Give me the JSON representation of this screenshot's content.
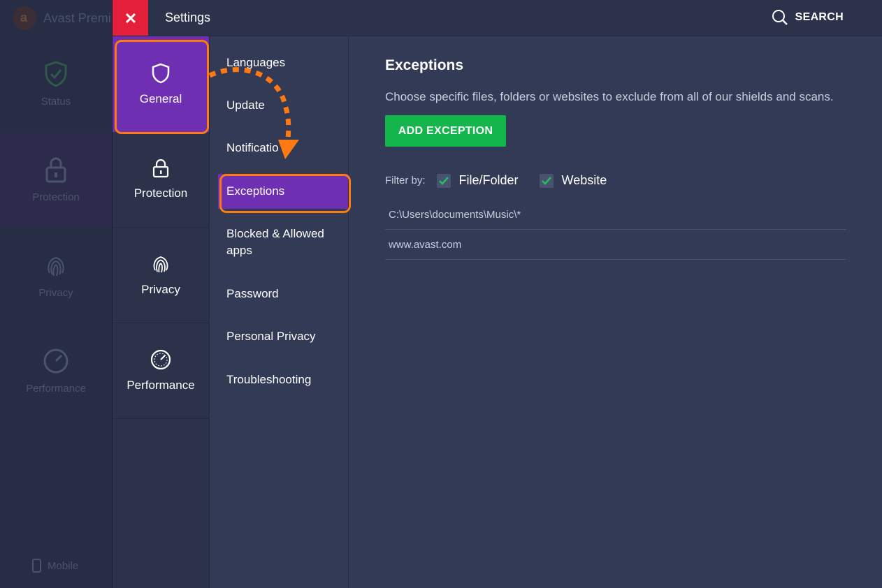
{
  "background_app": {
    "title": "Avast Premi",
    "nav": [
      {
        "label": "Status",
        "icon": "shield-check-icon"
      },
      {
        "label": "Protection",
        "icon": "lock-icon"
      },
      {
        "label": "Privacy",
        "icon": "fingerprint-icon"
      },
      {
        "label": "Performance",
        "icon": "speedometer-icon"
      }
    ],
    "mobile_label": "Mobile"
  },
  "topbar": {
    "title": "Settings",
    "search_label": "SEARCH"
  },
  "categories": [
    {
      "label": "General",
      "icon": "shield-icon",
      "active": true
    },
    {
      "label": "Protection",
      "icon": "lock-icon"
    },
    {
      "label": "Privacy",
      "icon": "fingerprint-icon"
    },
    {
      "label": "Performance",
      "icon": "speedometer-icon"
    }
  ],
  "submenu": [
    {
      "label": "Languages"
    },
    {
      "label": "Update"
    },
    {
      "label": "Notificatio"
    },
    {
      "label": "Exceptions",
      "active": true
    },
    {
      "label": "Blocked & Allowed apps"
    },
    {
      "label": "Password"
    },
    {
      "label": "Personal Privacy"
    },
    {
      "label": "Troubleshooting"
    }
  ],
  "exceptions": {
    "title": "Exceptions",
    "description": "Choose specific files, folders or websites to exclude from all of our shields and scans.",
    "add_button": "ADD EXCEPTION",
    "filter_label": "Filter by:",
    "filters": [
      {
        "label": "File/Folder",
        "checked": true
      },
      {
        "label": "Website",
        "checked": true
      }
    ],
    "items": [
      "C:\\Users\\documents\\Music\\*",
      "www.avast.com"
    ]
  },
  "colors": {
    "accent_purple": "#6f2fb3",
    "highlight_orange": "#ff7a11",
    "close_red": "#e31f3a",
    "add_green": "#12b64b",
    "check_green": "#1fc160"
  }
}
